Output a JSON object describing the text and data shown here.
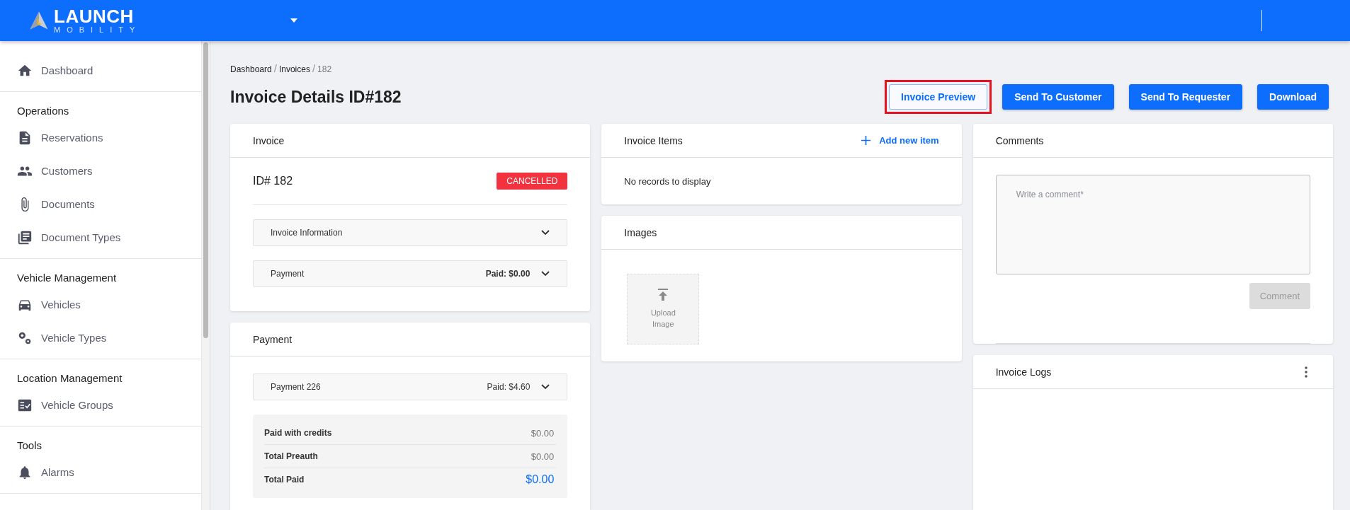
{
  "brand": {
    "name": "LAUNCH",
    "tagline": "MOBILITY"
  },
  "sidebar": {
    "top": [
      {
        "label": "Dashboard",
        "kind": "home"
      }
    ],
    "sections": [
      {
        "title": "Operations",
        "items": [
          {
            "label": "Reservations",
            "kind": "file"
          },
          {
            "label": "Customers",
            "kind": "people"
          },
          {
            "label": "Documents",
            "kind": "clip"
          },
          {
            "label": "Document Types",
            "kind": "docs"
          }
        ]
      },
      {
        "title": "Vehicle Management",
        "items": [
          {
            "label": "Vehicles",
            "kind": "car"
          },
          {
            "label": "Vehicle Types",
            "kind": "gears"
          }
        ]
      },
      {
        "title": "Location Management",
        "items": [
          {
            "label": "Vehicle Groups",
            "kind": "checklist"
          }
        ]
      },
      {
        "title": "Tools",
        "items": [
          {
            "label": "Alarms",
            "kind": "bell"
          }
        ]
      }
    ]
  },
  "breadcrumb_separator": "/",
  "breadcrumb": [
    {
      "label": "Dashboard",
      "current": false
    },
    {
      "label": "Invoices",
      "current": false
    },
    {
      "label": "182",
      "current": true
    }
  ],
  "title": "Invoice Details ID#182",
  "actions": [
    {
      "label": "Invoice Preview",
      "kind": "outline",
      "highlighted": true
    },
    {
      "label": "Send To Customer",
      "kind": "primary",
      "highlighted": false
    },
    {
      "label": "Send To Requester",
      "kind": "primary",
      "highlighted": false
    },
    {
      "label": "Download",
      "kind": "primary",
      "highlighted": false
    }
  ],
  "invoice_card": {
    "title": "Invoice",
    "id": "ID# 182",
    "status": "CANCELLED",
    "panels": [
      {
        "label": "Invoice Information",
        "expanded": false
      },
      {
        "label": "Payment",
        "amount": "Paid: $0.00",
        "emphasized": true,
        "expanded": false
      }
    ]
  },
  "payment_card": {
    "title": "Payment",
    "panels": [
      {
        "label": "Payment 226",
        "amount": "Paid: $4.60",
        "emphasized": false,
        "expanded": false
      }
    ],
    "totals": [
      {
        "label": "Paid with credits",
        "value": "$0.00",
        "kind": "plain"
      },
      {
        "label": "Total Preauth",
        "value": "$0.00",
        "kind": "plain"
      },
      {
        "label": "Total Paid",
        "value": "$0.00",
        "kind": "total"
      }
    ]
  },
  "items_card": {
    "title": "Invoice Items",
    "action": "Add new item",
    "empty": "No records to display"
  },
  "images_card": {
    "title": "Images",
    "upload": "Upload Image"
  },
  "comments_card": {
    "title": "Comments",
    "placeholder": "Write a comment*",
    "button": {
      "label": "Comment",
      "disabled": true
    }
  },
  "logs_card": {
    "title": "Invoice Logs"
  }
}
